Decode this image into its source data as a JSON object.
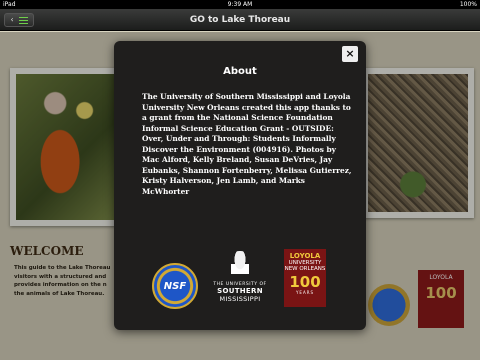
{
  "statusbar": {
    "carrier": "iPad",
    "time": "9:39 AM",
    "battery": "100%"
  },
  "navbar": {
    "title": "GO to Lake Thoreau",
    "back_icon": "chevron-left-icon",
    "menu_icon": "menu-icon"
  },
  "background": {
    "welcome": "WELCOME",
    "intro": "This guide to the Lake Thoreau visitors with a structured and provides information on the n the animals of Lake Thoreau."
  },
  "modal": {
    "title": "About",
    "close_label": "×",
    "body": "The University of Southern Mississippi and Loyola University New Orleans created this app thanks to a grant from the National Science Foundation Informal Science Education Grant - OUTSIDE: Over, Under and Through: Students Informally Discover the Environment (004916). Photos by Mac Alford, Kelly Breland, Susan DeVries, Jay Eubanks, Shannon Fortenberry, Melissa Gutierrez, Kristy Halverson, Jen Lamb, and Marks McWhorter",
    "logos": {
      "nsf": "NSF",
      "usm_line1": "THE UNIVERSITY OF",
      "usm_line2": "SOUTHERN",
      "usm_line3": "MISSISSIPPI",
      "loyola_line1": "LOYOLA",
      "loyola_line2": "UNIVERSITY",
      "loyola_line3": "NEW ORLEANS",
      "loyola_100": "100",
      "loyola_years": "YEARS"
    }
  }
}
